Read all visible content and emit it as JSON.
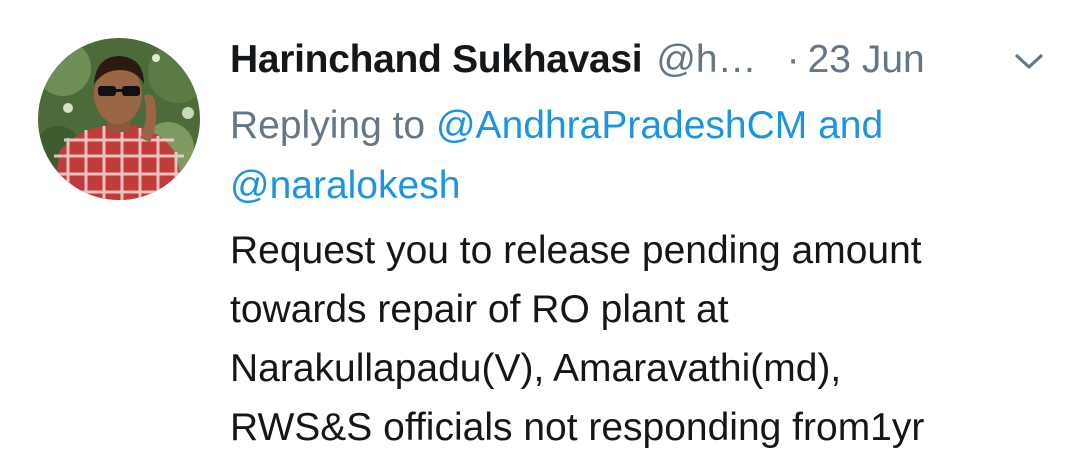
{
  "tweet": {
    "author": {
      "display_name": "Harinchand Sukhavasi",
      "handle": "@h…",
      "avatar_icon": "avatar-photo"
    },
    "separator": "·",
    "timestamp": "23 Jun",
    "menu_icon": "chevron-down-icon",
    "reply": {
      "prefix": "Replying to",
      "mention_1": "@AndhraPradeshCM",
      "conjunction": "and",
      "mention_2": "@naralokesh"
    },
    "text_lines": [
      "Request you to release pending amount",
      "towards repair of RO plant at",
      "Narakullapadu(V), Amaravathi(md),",
      "RWS&S officials not responding from1yr"
    ]
  },
  "colors": {
    "name": "#14171a",
    "secondary": "#657786",
    "link": "#1b95e0",
    "background": "#ffffff"
  }
}
